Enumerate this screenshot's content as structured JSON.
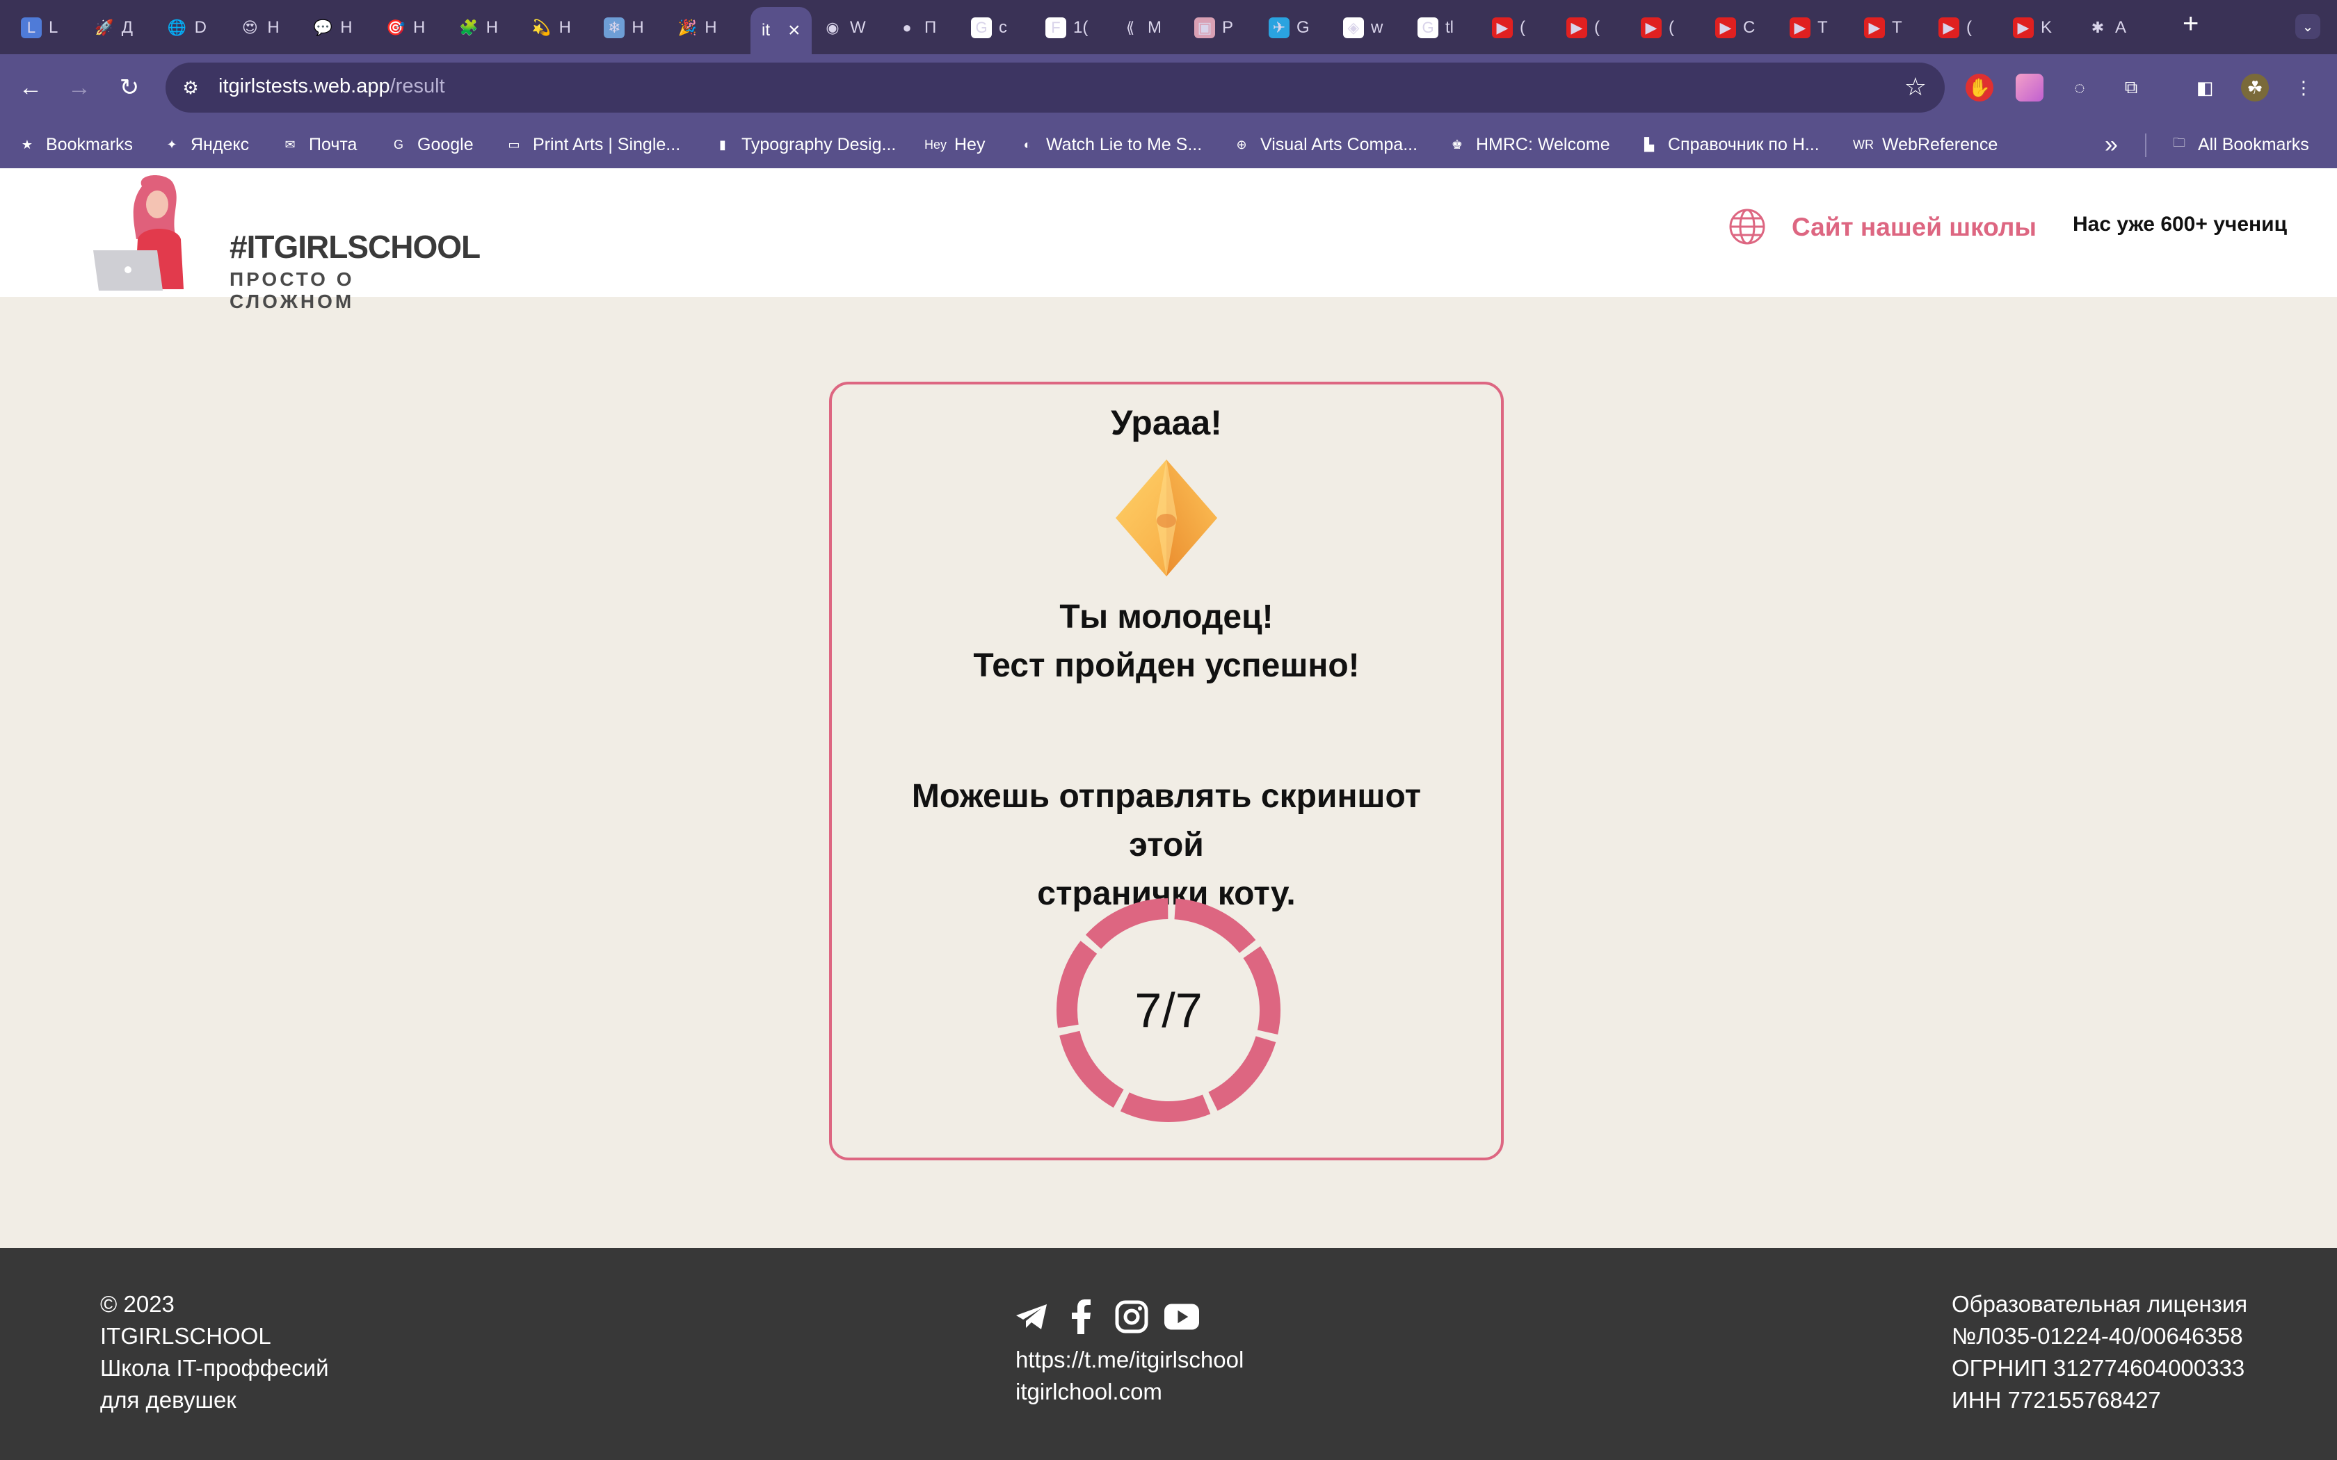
{
  "browser": {
    "tabs": [
      {
        "glyph": "L",
        "label": "L",
        "color": "#4f7bd8"
      },
      {
        "glyph": "🚀",
        "label": "Д",
        "color": "transparent"
      },
      {
        "glyph": "🌐",
        "label": "D",
        "color": "transparent"
      },
      {
        "glyph": "😍",
        "label": "Н",
        "color": "transparent"
      },
      {
        "glyph": "💬",
        "label": "Н",
        "color": "transparent"
      },
      {
        "glyph": "🎯",
        "label": "Н",
        "color": "transparent"
      },
      {
        "glyph": "🧩",
        "label": "Н",
        "color": "transparent"
      },
      {
        "glyph": "💫",
        "label": "Н",
        "color": "transparent"
      },
      {
        "glyph": "❄",
        "label": "Н",
        "color": "#6e9ed6"
      },
      {
        "glyph": "🎉",
        "label": "Н",
        "color": "transparent"
      },
      {
        "glyph": "",
        "label": "it",
        "color": "transparent",
        "active": true
      },
      {
        "glyph": "◉",
        "label": "W",
        "color": "transparent"
      },
      {
        "glyph": "●",
        "label": "П",
        "color": "transparent"
      },
      {
        "glyph": "G",
        "label": "c",
        "color": "#ffffff"
      },
      {
        "glyph": "F",
        "label": "1(",
        "color": "#ffffff"
      },
      {
        "glyph": "⟪",
        "label": "M",
        "color": "transparent"
      },
      {
        "glyph": "▣",
        "label": "P",
        "color": "#d9a0b4"
      },
      {
        "glyph": "✈",
        "label": "G",
        "color": "#2aa3e0"
      },
      {
        "glyph": "◈",
        "label": "w",
        "color": "#ffffff"
      },
      {
        "glyph": "G",
        "label": "tl",
        "color": "#ffffff"
      },
      {
        "glyph": "▶",
        "label": "(",
        "color": "#e02020"
      },
      {
        "glyph": "▶",
        "label": "(",
        "color": "#e02020"
      },
      {
        "glyph": "▶",
        "label": "(",
        "color": "#e02020"
      },
      {
        "glyph": "▶",
        "label": "C",
        "color": "#e02020"
      },
      {
        "glyph": "▶",
        "label": "T",
        "color": "#e02020"
      },
      {
        "glyph": "▶",
        "label": "T",
        "color": "#e02020"
      },
      {
        "glyph": "▶",
        "label": "(",
        "color": "#e02020"
      },
      {
        "glyph": "▶",
        "label": "K",
        "color": "#e02020"
      },
      {
        "glyph": "✱",
        "label": "A",
        "color": "transparent"
      }
    ],
    "new_tab": "+",
    "url_host": "itgirlstests.web.app",
    "url_path": "/result",
    "bookmarks": [
      {
        "icon": "★",
        "label": "Bookmarks"
      },
      {
        "icon": "✦",
        "label": "Яндекс"
      },
      {
        "icon": "✉",
        "label": "Почта"
      },
      {
        "icon": "G",
        "label": "Google"
      },
      {
        "icon": "▭",
        "label": "Print Arts | Single..."
      },
      {
        "icon": "▮",
        "label": "Typography Desig..."
      },
      {
        "icon": "Hey",
        "label": "Hey"
      },
      {
        "icon": "◐",
        "label": "Watch Lie to Me S..."
      },
      {
        "icon": "⊕",
        "label": "Visual Arts Compa..."
      },
      {
        "icon": "♚",
        "label": "HMRC: Welcome"
      },
      {
        "icon": "▙",
        "label": "Справочник по Н..."
      },
      {
        "icon": "WR",
        "label": "WebReference"
      }
    ],
    "more_bookmarks": "»",
    "all_bookmarks": "All Bookmarks"
  },
  "header": {
    "logo_title": "#ITGIRLSCHOOL",
    "logo_subtitle": "ПРОСТО О СЛОЖНОМ",
    "school_link": "Сайт нашей школы",
    "students": "Нас уже 600+ учениц"
  },
  "result": {
    "title": "Урааа!",
    "praise_line1": "Ты молодец!",
    "praise_line2": "Тест пройден успешно!",
    "note_line1": "Можешь отправлять скриншот этой",
    "note_line2": "странички коту.",
    "score": "7/7",
    "correct": 7,
    "total": 7,
    "accent_color": "#dd6681"
  },
  "footer": {
    "left": [
      "© 2023",
      "ITGIRLSCHOOL",
      "Школа IT-проффесий",
      "для девушек"
    ],
    "social_icons": [
      "telegram-icon",
      "facebook-icon",
      "instagram-icon",
      "youtube-icon"
    ],
    "links": [
      "https://t.me/itgirlschool",
      "itgirlchool.com"
    ],
    "right": [
      "Образовательная лицензия",
      "№Л035-01224-40/00646358",
      "ОГРНИП 312774604000333",
      "ИНН 772155768427"
    ]
  }
}
